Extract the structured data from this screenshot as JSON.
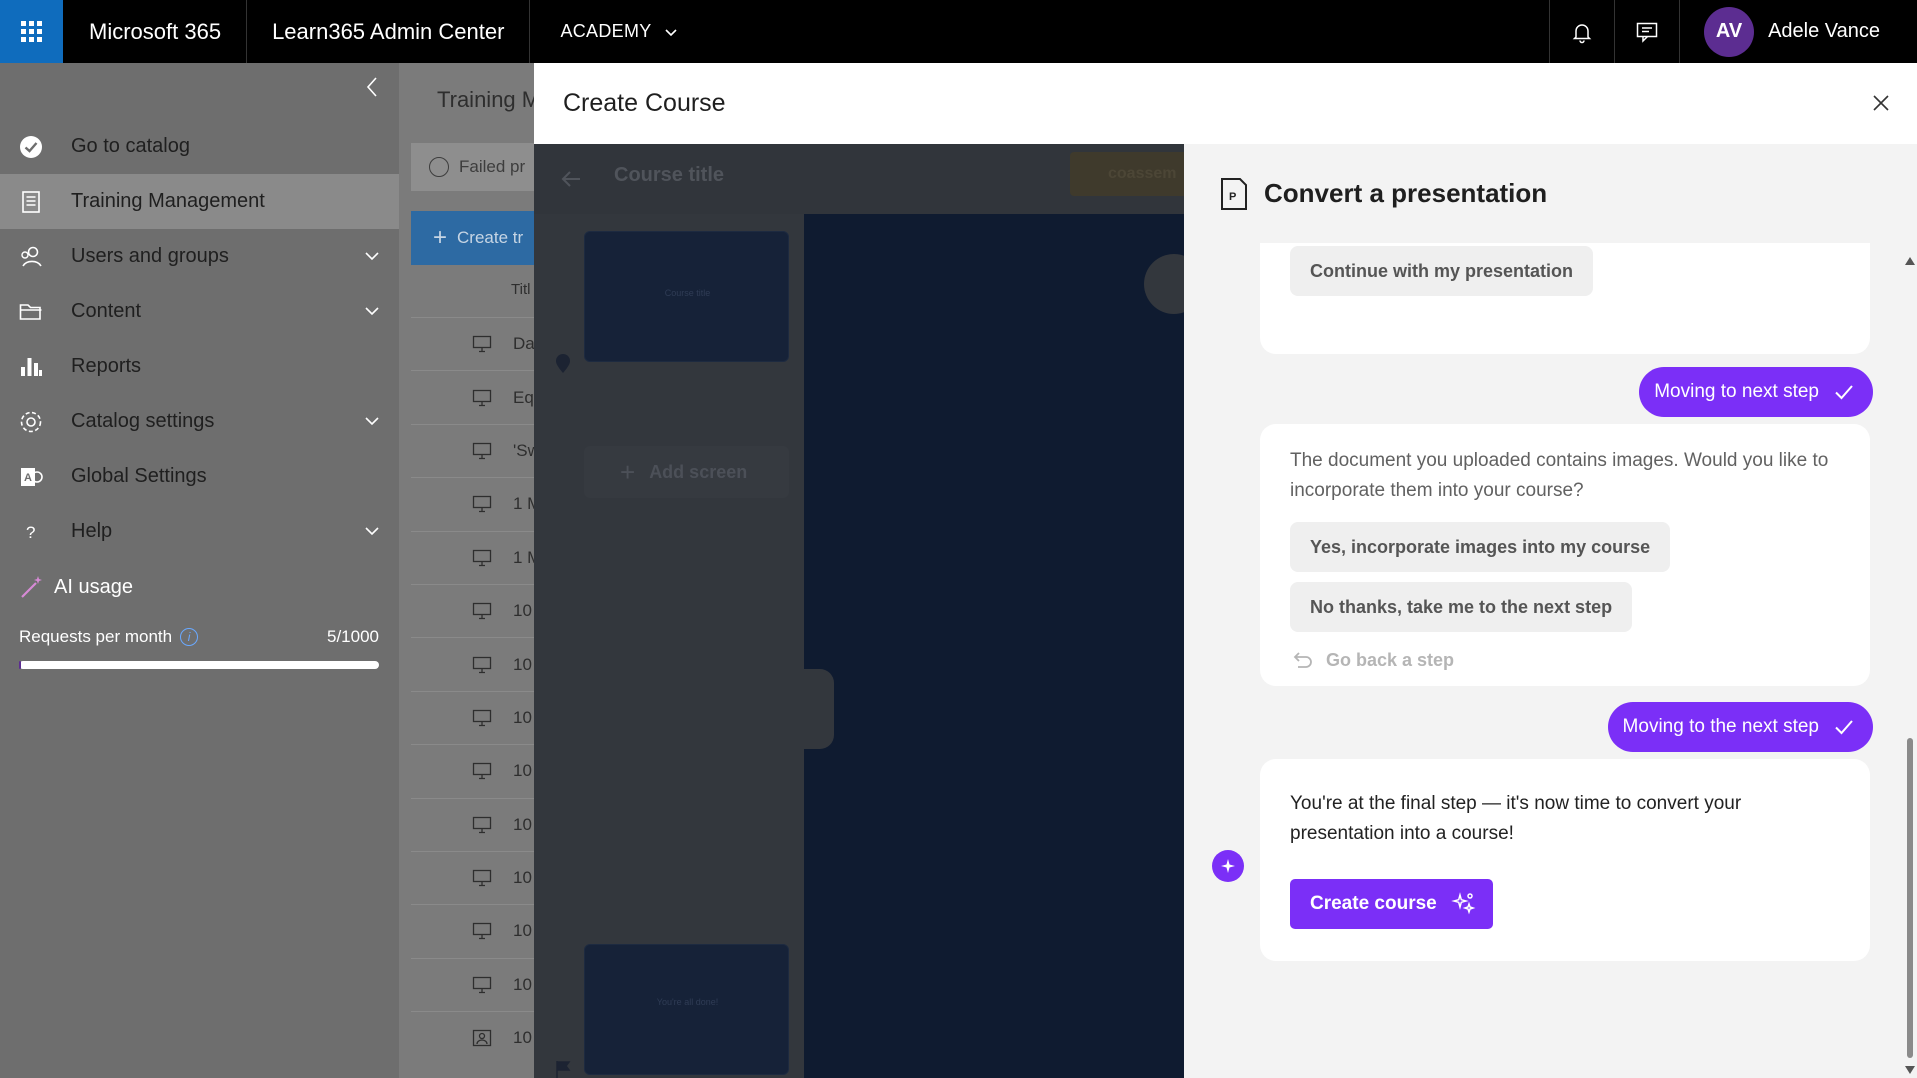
{
  "topbar": {
    "brand": "Microsoft 365",
    "app_name": "Learn365 Admin Center",
    "tenant": "ACADEMY",
    "user_initials": "AV",
    "user_name": "Adele Vance"
  },
  "sidebar": {
    "items": [
      {
        "label": "Go to catalog",
        "icon": "check-circle-icon"
      },
      {
        "label": "Training Management",
        "icon": "document-icon",
        "active": true
      },
      {
        "label": "Users and groups",
        "icon": "people-icon",
        "expandable": true
      },
      {
        "label": "Content",
        "icon": "folder-icon",
        "expandable": true
      },
      {
        "label": "Reports",
        "icon": "bar-chart-icon"
      },
      {
        "label": "Catalog settings",
        "icon": "gear-icon",
        "expandable": true
      },
      {
        "label": "Global Settings",
        "icon": "global-settings-icon"
      },
      {
        "label": "Help",
        "icon": "question-icon",
        "expandable": true
      }
    ],
    "ai_usage_label": "AI usage",
    "requests_label": "Requests per month",
    "requests_value": "5/1000",
    "requests_fraction": 0.005
  },
  "background": {
    "page_title": "Training M",
    "search_text": "Failed pr",
    "create_label": "Create tr",
    "column_title": "Titl",
    "rows": [
      "Da",
      "Eq",
      "'Sw",
      "1 M",
      "1 M",
      "10",
      "10",
      "10",
      "10",
      "10",
      "10",
      "10",
      "10",
      "10"
    ]
  },
  "dialog": {
    "title": "Create Course"
  },
  "editor": {
    "course_title": "Course title",
    "badge": "coassem",
    "thumb1_text": "Course title",
    "add_screen": "Add screen",
    "thumb2_text": "You're all done!"
  },
  "panel": {
    "title": "Convert a presentation",
    "continue_chip": "Continue with my presentation",
    "pill1": "Moving to next step",
    "question": "The document you uploaded contains images. Would you like to incorporate them into your course?",
    "option_yes": "Yes, incorporate images into my course",
    "option_no": "No thanks, take me to the next step",
    "go_back": "Go back a step",
    "pill2": "Moving to the next step",
    "final_text": "You're at the final step — it's now time to convert your presentation into a course!",
    "create_button": "Create course"
  },
  "colors": {
    "accent_purple": "#7b2ff7",
    "brand_blue": "#0f6cbd",
    "avatar": "#5c2d91"
  }
}
